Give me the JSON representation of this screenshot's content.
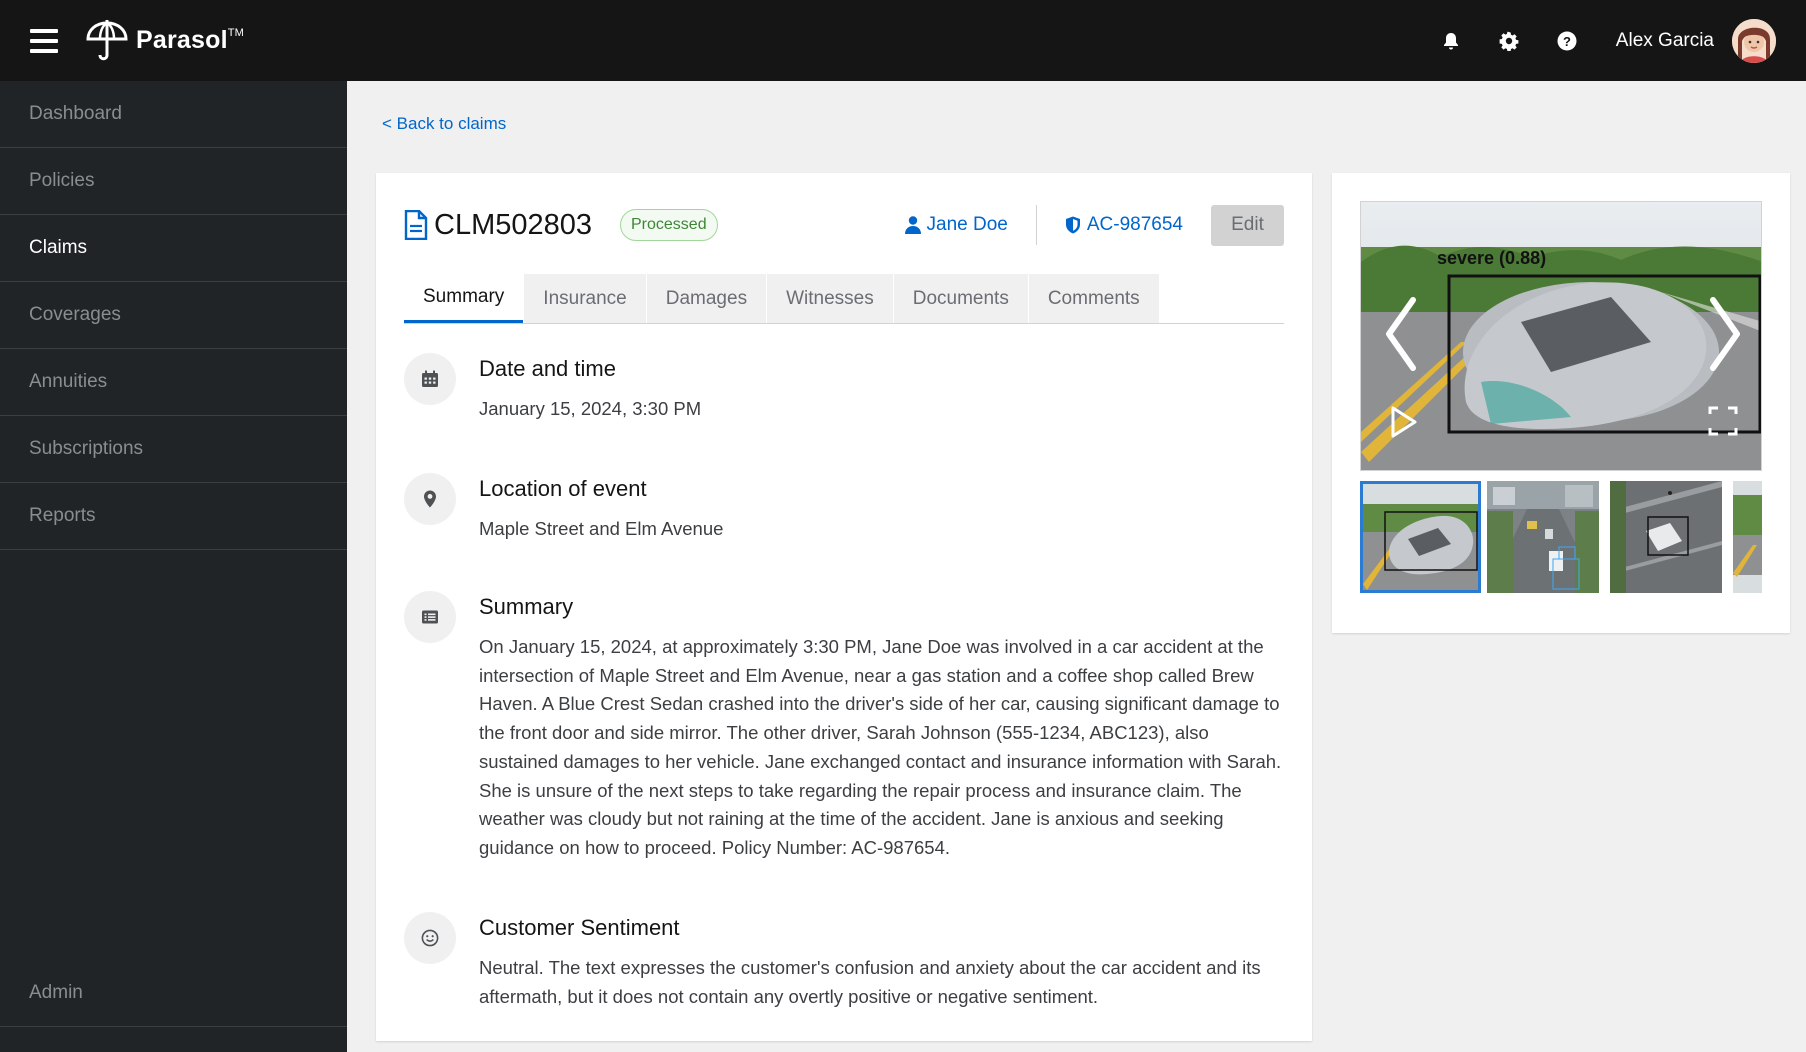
{
  "app": {
    "brand": "Parasol",
    "trademark": "TM",
    "user_name": "Alex Garcia"
  },
  "header_icons": [
    "menu-icon",
    "bell-icon",
    "gear-icon",
    "help-icon"
  ],
  "sidebar": {
    "items": [
      {
        "label": "Dashboard",
        "active": false
      },
      {
        "label": "Policies",
        "active": false
      },
      {
        "label": "Claims",
        "active": true
      },
      {
        "label": "Coverages",
        "active": false
      },
      {
        "label": "Annuities",
        "active": false
      },
      {
        "label": "Subscriptions",
        "active": false
      },
      {
        "label": "Reports",
        "active": false
      }
    ],
    "admin": "Admin"
  },
  "back_link": "< Back to claims",
  "claim": {
    "id": "CLM502803",
    "status": "Processed",
    "customer": "Jane Doe",
    "policy": "AC-987654",
    "edit_label": "Edit"
  },
  "tabs": [
    "Summary",
    "Insurance",
    "Damages",
    "Witnesses",
    "Documents",
    "Comments"
  ],
  "active_tab": "Summary",
  "sections": {
    "datetime": {
      "title": "Date and time",
      "value": "January 15, 2024, 3:30 PM"
    },
    "location": {
      "title": "Location of event",
      "value": "Maple Street and Elm Avenue"
    },
    "summary": {
      "title": "Summary",
      "value": "On January 15, 2024, at approximately 3:30 PM, Jane Doe was involved in a car accident at the intersection of Maple Street and Elm Avenue, near a gas station and a coffee shop called Brew Haven. A Blue Crest Sedan crashed into the driver's side of her car, causing significant damage to the front door and side mirror. The other driver, Sarah Johnson (555-1234, ABC123), also sustained damages to her vehicle. Jane exchanged contact and insurance information with Sarah. She is unsure of the next steps to take regarding the repair process and insurance claim. The weather was cloudy but not raining at the time of the accident. Jane is anxious and seeking guidance on how to proceed. Policy Number: AC-987654."
    },
    "sentiment": {
      "title": "Customer Sentiment",
      "value": "Neutral. The text expresses the customer's confusion and anxiety about the car accident and its aftermath, but it does not contain any overtly positive or negative sentiment."
    }
  },
  "carousel": {
    "detection_label": "severe (0.88)",
    "thumbnail_count": 4,
    "selected_index": 0
  },
  "colors": {
    "link": "#0066cc",
    "status_green": "#3e8635",
    "header_bg": "#151515",
    "sidebar_bg": "#212427"
  }
}
